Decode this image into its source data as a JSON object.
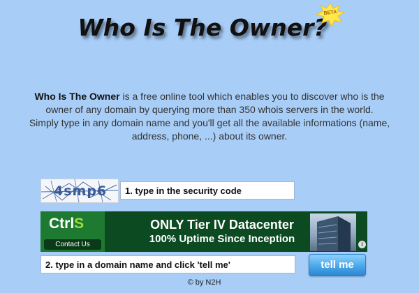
{
  "header": {
    "title": "Who Is The Owner?",
    "badge": "BETA"
  },
  "intro": {
    "brand": "Who Is The Owner",
    "line1": " is a free online tool which enables you to discover who is the owner of any domain by querying more than 350 whois servers in the world.",
    "line2": "Simply type in any domain name and you'll get all the available informations (name, address, phone, ...) about its owner."
  },
  "captcha": {
    "code": "4smp6",
    "field_value": "1. type in the security code"
  },
  "ad": {
    "logo_ctrl": "Ctrl",
    "logo_s": "S",
    "contact_label": "Contact Us",
    "headline": "ONLY Tier IV Datacenter",
    "subline": "100% Uptime Since Inception",
    "info_icon": "i"
  },
  "domain": {
    "field_value": "2. type in a domain name and click 'tell me'"
  },
  "submit_label": "tell me",
  "footer": "© by N2H",
  "colors": {
    "background": "#a8cdf7",
    "ad_green": "#0c4a22",
    "button_blue": "#4aa8ea"
  }
}
